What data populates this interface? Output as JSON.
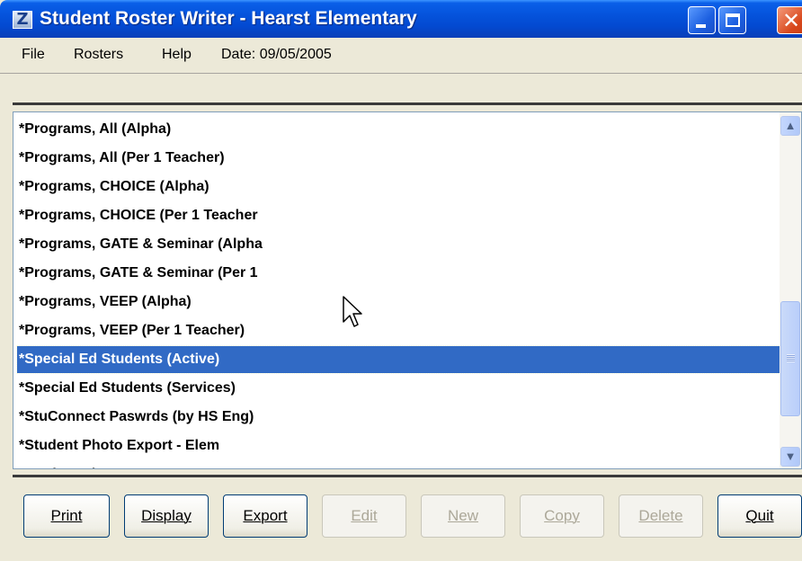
{
  "window": {
    "title": "Student Roster Writer - Hearst Elementary",
    "app_icon_glyph": "Z",
    "controls": {
      "minimize": "minimize-icon",
      "maximize": "maximize-icon",
      "close": "close-icon"
    }
  },
  "menubar": {
    "items": [
      "File",
      "Rosters",
      "Help"
    ],
    "date_label": "Date: 09/05/2005"
  },
  "roster_list": {
    "items": [
      "*Programs, All (Alpha)",
      "*Programs, All (Per 1 Teacher)",
      "*Programs, CHOICE (Alpha)",
      "*Programs, CHOICE (Per 1 Teacher",
      "*Programs, GATE & Seminar (Alpha",
      "*Programs, GATE & Seminar (Per 1",
      "*Programs, VEEP (Alpha)",
      "*Programs, VEEP (Per 1 Teacher)",
      "*Special Ed Students (Active)",
      "*Special Ed Students (Services)",
      "*StuConnect Paswrds (by HS Eng)",
      "*Student Photo Export - Elem",
      "*Student Photo Export - Sec"
    ],
    "selected_index": 8,
    "scroll_fraction": 0.62
  },
  "buttons": {
    "print": "Print",
    "display": "Display",
    "export": "Export",
    "edit": "Edit",
    "new": "New",
    "copy": "Copy",
    "delete": "Delete",
    "quit": "Quit"
  }
}
